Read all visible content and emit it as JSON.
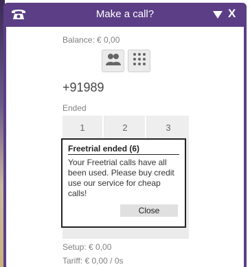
{
  "window": {
    "title": "Make a call?",
    "close_label": "X",
    "phone_icon": "phone-icon",
    "minimize_icon": "chevron-down-icon"
  },
  "account": {
    "balance": "Balance: € 0,00"
  },
  "mode_buttons": {
    "contacts_icon": "contacts-icon",
    "keypad_icon": "dialpad-icon"
  },
  "call": {
    "number": "+91989",
    "status": "Ended"
  },
  "keypad": {
    "keys": [
      "1",
      "2",
      "3"
    ]
  },
  "popup": {
    "title": "Freetrial ended (6)",
    "message": "Your Freetrial calls have all been used. Please buy credit use our service for cheap calls!",
    "close_label": "Close"
  },
  "costs": {
    "setup": "Setup: € 0,00",
    "tariff": "Tariff:  € 0,00 / 0s"
  },
  "colors": {
    "titlebar": "#5c3e86",
    "panel": "#ffffff",
    "key_bg": "#eeeeee"
  }
}
